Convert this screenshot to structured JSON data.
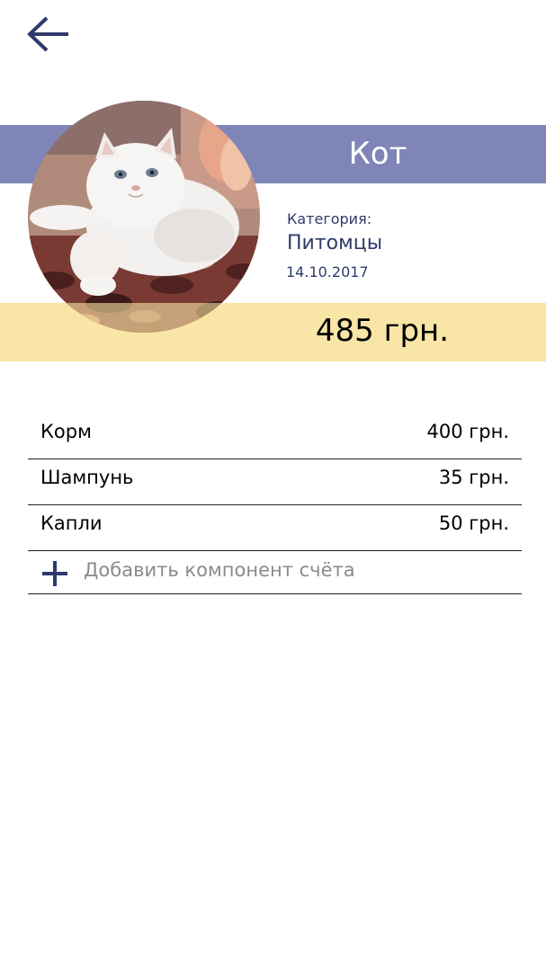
{
  "header": {
    "back_icon": "arrow-left-icon",
    "title": "Кот"
  },
  "bill": {
    "total": "485 грн.",
    "category_label": "Категория:",
    "category_value": "Питомцы",
    "date": "14.10.2017"
  },
  "items": [
    {
      "name": "Корм",
      "amount": "400 грн."
    },
    {
      "name": "Шампунь",
      "amount": "35 грн."
    },
    {
      "name": "Капли",
      "amount": "50 грн."
    }
  ],
  "add_component": {
    "icon": "plus-icon",
    "label": "Добавить компонент счёта"
  },
  "colors": {
    "title_band": "#7f86b7",
    "price_band": "#f9e5a5",
    "accent": "#2f3a6b"
  }
}
